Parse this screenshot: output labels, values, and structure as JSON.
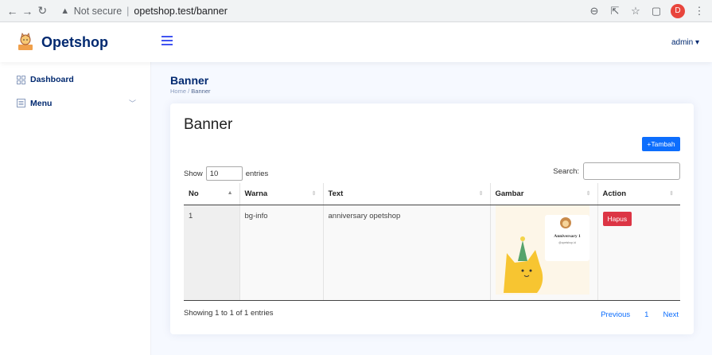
{
  "browser": {
    "security_label": "Not secure",
    "url": "opetshop.test/banner",
    "profile_initial": "D"
  },
  "header": {
    "brand": "Opetshop",
    "user": "admin ▾"
  },
  "sidebar": {
    "items": [
      {
        "label": "Dashboard",
        "icon": "grid-icon"
      },
      {
        "label": "Menu",
        "icon": "menu-icon"
      }
    ]
  },
  "page": {
    "title": "Banner",
    "breadcrumb_home": "Home",
    "breadcrumb_sep": "/",
    "breadcrumb_current": "Banner"
  },
  "card": {
    "title": "Banner",
    "add_button": "+Tambah",
    "show_label": "Show",
    "entries_value": "10",
    "entries_label": "entries",
    "search_label": "Search:",
    "columns": [
      "No",
      "Warna",
      "Text",
      "Gambar",
      "Action"
    ],
    "rows": [
      {
        "no": "1",
        "warna": "bg-info",
        "text": "anniversary opetshop",
        "action": "Hapus"
      }
    ],
    "thumbnail_text": {
      "title": "Anniversary 1",
      "handle": "@opetshop.id"
    },
    "info": "Showing 1 to 1 of 1 entries",
    "pagination": {
      "previous": "Previous",
      "page": "1",
      "next": "Next"
    }
  },
  "colors": {
    "primary": "#0d6efd",
    "danger": "#dc3545",
    "brand": "#012970"
  }
}
